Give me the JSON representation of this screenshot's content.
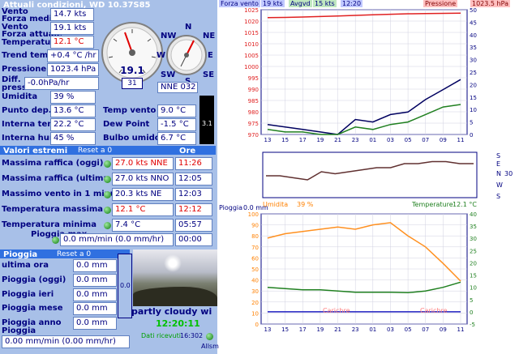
{
  "header": {
    "title": "Attuali condizioni, WD 10.37S85"
  },
  "current": {
    "wind_label": "Vento",
    "avg_wind_label": "Forza media",
    "wind_value": "14.7 kts",
    "current_wind_label1": "Vento",
    "current_wind_label2": "Forza attuale",
    "current_wind_value": "19.1 kts",
    "temp_label": "Temperatura",
    "temp_value": "12.1 °C",
    "temp_trend_label": "Trend temp",
    "temp_trend_value": "+0.4 °C /hr",
    "pressure_label": "Pressione",
    "pressure_value": "1023.4 hPa",
    "diff_pressure_label": "Diff. pressione",
    "diff_pressure_value": "-0.0hPa/hr",
    "humidity_label": "Umidita",
    "humidity_value": "39 %",
    "dewpoint_label": "Punto dep.",
    "dewpoint_value": "13.6 °C",
    "indoor_temp_label": "Interna temp.",
    "indoor_temp_value": "22.2 °C",
    "indoor_hum_label": "Interna hum",
    "indoor_hum_value": "45 %",
    "windchill_label": "Temp vento",
    "windchill_value": "9.0 °C",
    "dew_point_label": "Dew Point",
    "dew_point_value": "-1.5 °C",
    "wetbulb_label": "Bulbo umido",
    "wetbulb_value": "6.7 °C",
    "uv_value": "3.1"
  },
  "gauges": {
    "speed_value": "19.1",
    "speed_sub": "31",
    "compass": {
      "n": "N",
      "ne": "NE",
      "e": "E",
      "se": "SE",
      "s": "S",
      "sw": "SW",
      "w": "W",
      "nw": "NW"
    },
    "direction_value": "NNE 032 °"
  },
  "extremes": {
    "title": "Valori estremi",
    "reset": "Reset a 0",
    "time_header": "Ore",
    "rows": [
      {
        "label": "Massima raffica (oggi)",
        "value": "27.0 kts NNE",
        "time": "11:26",
        "red": true
      },
      {
        "label": "Massima raffica (ultima ora)",
        "value": "27.0 kts NNO",
        "time": "12:05",
        "red": false
      },
      {
        "label": "Massimo vento in 1 minuto",
        "value": "20.3 kts  NE",
        "time": "12:03",
        "red": false
      },
      {
        "label": "Temperatura massima",
        "value": "12.1 °C",
        "time": "12:12",
        "red": true
      },
      {
        "label": "Temperatura minima",
        "value": "7.4 °C",
        "time": "05:57",
        "red": false
      }
    ],
    "rain_max_label": "Pioggia max",
    "rain_max_value": "0.0 mm/min (0.0 mm/hr)",
    "rain_max_time": "00:00"
  },
  "rain": {
    "title": "Pioggia",
    "reset": "Reset a 0",
    "rows": [
      {
        "label": "ultima ora",
        "value": "0.0 mm"
      },
      {
        "label": "Pioggia (oggi)",
        "value": "0.0 mm"
      },
      {
        "label": "Pioggia ieri",
        "value": "0.0 mm"
      },
      {
        "label": "Pioggia mese",
        "value": "0.0 mm"
      },
      {
        "label": "Pioggia anno",
        "value": "0.0 mm"
      }
    ],
    "rate_label": "Pioggia",
    "rate_value": "0.00 mm/min (0.00 mm/hr)",
    "gauge_value": "0.0"
  },
  "webcam": {
    "caption": "partly cloudy wi",
    "clock": "12:20:11",
    "received_label": "Dati ricevuti",
    "received_time": "16:302",
    "alarm_label": "Allsm"
  },
  "top_legend": {
    "wind_label": "Forza vento",
    "wind_value": "19 kts",
    "avg_label": "Avgvd",
    "avg_value": "15 kts",
    "time": "12:20",
    "pressure_label": "Pressione",
    "pressure_value": "1023.5 hPa"
  },
  "mid_chart": {
    "right_labels": [
      "S",
      "E",
      "N",
      "30",
      "W",
      "S"
    ]
  },
  "bottom_legend": {
    "rain_label": "Pioggia",
    "rain_value": "0.0 mm",
    "hum_label": "Umidita",
    "hum_value": "39 %",
    "temp_label": "Temperature",
    "temp_value": "12.1 °C",
    "overlay1": "Carichre",
    "overlay2": "Carichre"
  },
  "chart_data": [
    {
      "type": "line",
      "x_ticks": [
        "13",
        "15",
        "17",
        "19",
        "21",
        "23",
        "01",
        "03",
        "05",
        "07",
        "09",
        "11"
      ],
      "y_left": {
        "ylim": [
          970,
          1025
        ],
        "ticks": [
          970,
          975,
          980,
          985,
          990,
          995,
          1000,
          1005,
          1010,
          1015,
          1020,
          1025
        ]
      },
      "y_right": {
        "ylim": [
          0,
          50
        ],
        "ticks": [
          0,
          5,
          10,
          15,
          20,
          25,
          30,
          35,
          40,
          45,
          50
        ]
      },
      "series": [
        {
          "name": "Pressione",
          "axis": "left",
          "color": "#e02020",
          "values": [
            1021.5,
            1021.6,
            1021.8,
            1022,
            1022.2,
            1022.5,
            1022.8,
            1023,
            1023.2,
            1023.3,
            1023.4,
            1023.5
          ]
        },
        {
          "name": "Forza vento",
          "axis": "right",
          "color": "#000060",
          "values": [
            4,
            3,
            2,
            1,
            0,
            6,
            5,
            8,
            9,
            14,
            18,
            22
          ]
        },
        {
          "name": "Avgvd",
          "axis": "right",
          "color": "#208020",
          "values": [
            2,
            1,
            1,
            0,
            0,
            3,
            2,
            4,
            5,
            8,
            11,
            12
          ]
        }
      ]
    },
    {
      "type": "line",
      "x_ticks": [],
      "series": [
        {
          "name": "",
          "color": "#603030",
          "values": [
            10,
            10,
            9,
            8,
            12,
            11,
            12,
            13,
            14,
            14,
            16,
            16,
            17,
            17,
            16,
            16
          ]
        }
      ]
    },
    {
      "type": "line",
      "x_ticks": [
        "13",
        "15",
        "17",
        "19",
        "21",
        "23",
        "01",
        "03",
        "05",
        "07",
        "09",
        "11"
      ],
      "y_left": {
        "ylim": [
          0,
          100
        ],
        "ticks": [
          0,
          10,
          20,
          30,
          40,
          50,
          60,
          70,
          80,
          90,
          100
        ]
      },
      "y_right": {
        "ylim": [
          -5,
          40
        ],
        "ticks": [
          -5,
          0,
          5,
          10,
          15,
          20,
          25,
          30,
          35,
          40
        ]
      },
      "series": [
        {
          "name": "Umidita",
          "axis": "left",
          "color": "#ff9020",
          "values": [
            78,
            82,
            84,
            86,
            88,
            86,
            90,
            92,
            80,
            70,
            55,
            39
          ]
        },
        {
          "name": "Temperature",
          "axis": "right",
          "color": "#208020",
          "values": [
            10,
            9.5,
            9,
            9,
            8.5,
            8,
            8,
            8,
            7.8,
            8.5,
            10,
            12.1
          ]
        },
        {
          "name": "Pioggia",
          "axis": "right",
          "color": "#2020c0",
          "values": [
            0,
            0,
            0,
            0,
            0,
            0,
            0,
            0,
            0,
            0,
            0,
            0
          ]
        }
      ]
    }
  ]
}
